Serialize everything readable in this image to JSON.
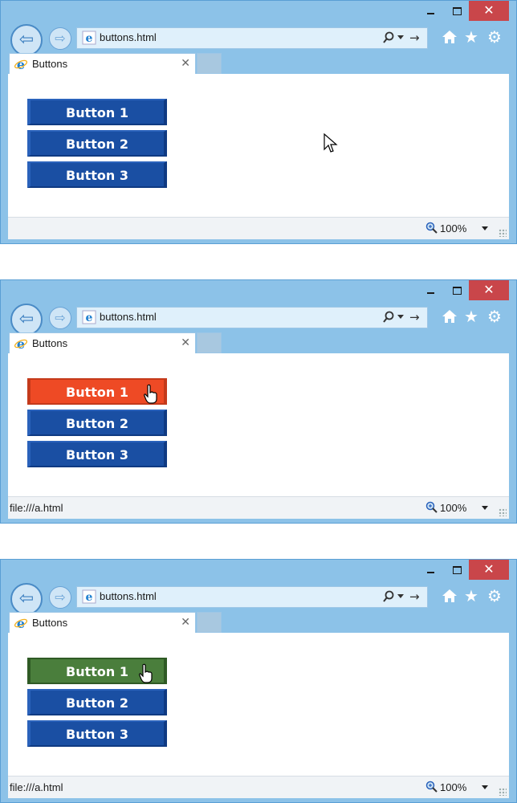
{
  "windows": [
    {
      "address": "buttons.html",
      "tab_title": "Buttons",
      "buttons": [
        {
          "label": "Button 1",
          "state": "normal"
        },
        {
          "label": "Button 2",
          "state": "normal"
        },
        {
          "label": "Button 3",
          "state": "normal"
        }
      ],
      "status_text": "",
      "zoom": "100%",
      "cursor": "arrow"
    },
    {
      "address": "buttons.html",
      "tab_title": "Buttons",
      "buttons": [
        {
          "label": "Button 1",
          "state": "hover"
        },
        {
          "label": "Button 2",
          "state": "normal"
        },
        {
          "label": "Button 3",
          "state": "normal"
        }
      ],
      "status_text": "file:///a.html",
      "zoom": "100%",
      "cursor": "hand"
    },
    {
      "address": "buttons.html",
      "tab_title": "Buttons",
      "buttons": [
        {
          "label": "Button 1",
          "state": "active"
        },
        {
          "label": "Button 2",
          "state": "normal"
        },
        {
          "label": "Button 3",
          "state": "normal"
        }
      ],
      "status_text": "file:///a.html",
      "zoom": "100%",
      "cursor": "hand"
    }
  ],
  "caption": {
    "close_glyph": "✕"
  },
  "colors": {
    "button_normal": "#1a4fa3",
    "button_hover": "#ee4a25",
    "button_active": "#4a7e3c",
    "chrome": "#8cc2e8"
  },
  "icons": [
    "back-arrow-icon",
    "forward-arrow-icon",
    "ie-logo-icon",
    "search-icon",
    "refresh-go-icon",
    "home-icon",
    "star-icon",
    "gear-icon",
    "zoom-icon",
    "cursor-icon"
  ]
}
